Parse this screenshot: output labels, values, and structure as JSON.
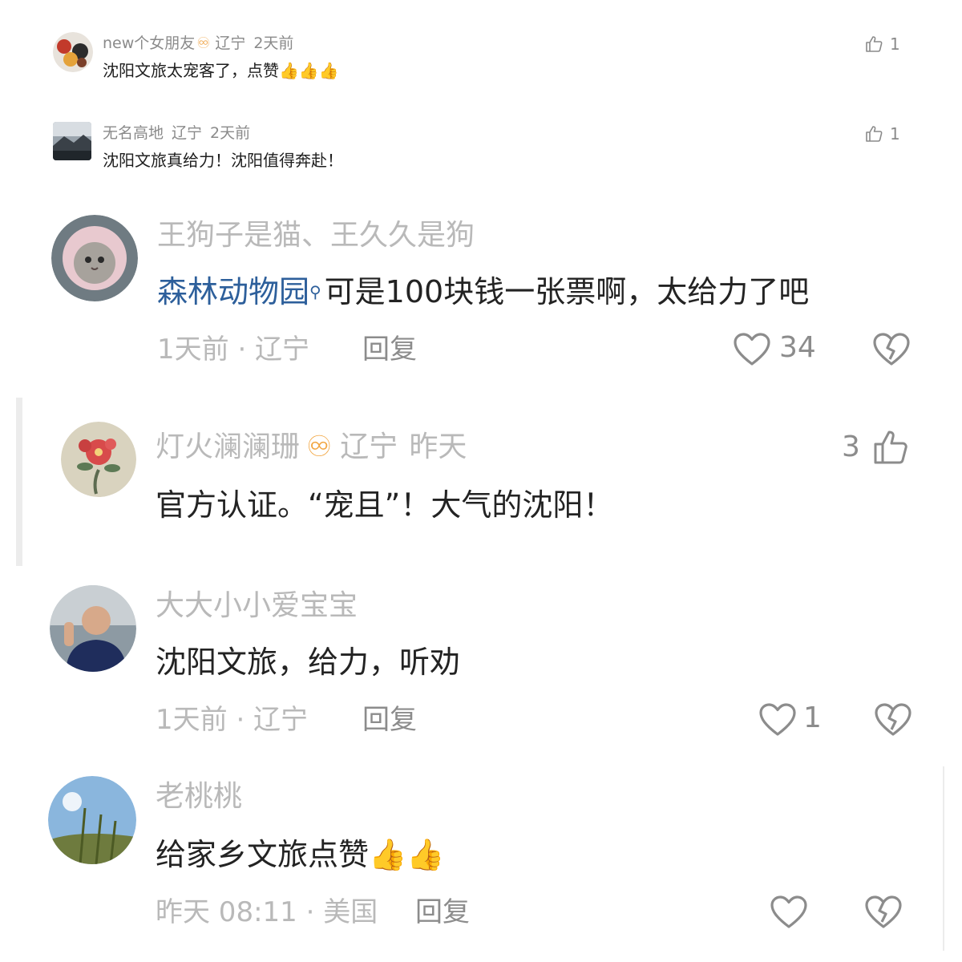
{
  "comments_small": [
    {
      "name": "new个女朋友",
      "vip_icon": "vip-badge-icon",
      "location": "辽宁",
      "time": "2天前",
      "text": "沈阳文旅太宠客了，点赞",
      "emoji": "👍👍👍",
      "likes": "1"
    },
    {
      "name": "无名高地",
      "location": "辽宁",
      "time": "2天前",
      "text": "沈阳文旅真给力！沈阳值得奔赴！",
      "likes": "1"
    }
  ],
  "comments_large": [
    {
      "name": "王狗子是猫、王久久是狗",
      "mention": "森林动物园",
      "text": "可是100块钱一张票啊，太给力了吧",
      "meta": "1天前 · 辽宁",
      "reply_label": "回复",
      "likes": "34"
    },
    {
      "name": "灯火澜澜珊",
      "location": "辽宁",
      "time": "昨天",
      "text": "官方认证。“宠且”！大气的沈阳！",
      "likes": "3"
    },
    {
      "name": "大大小小爱宝宝",
      "text": "沈阳文旅，给力，听劝",
      "meta": "1天前 · 辽宁",
      "reply_label": "回复",
      "likes": "1"
    },
    {
      "name": "老桃桃",
      "text": "给家乡文旅点赞",
      "emoji": "👍👍",
      "meta": "昨天 08:11 · 美国",
      "reply_label": "回复"
    }
  ],
  "colors": {
    "name_gray": "#b9b9b9",
    "mention_blue": "#2d5f9b",
    "vip_orange": "#f2a642"
  }
}
